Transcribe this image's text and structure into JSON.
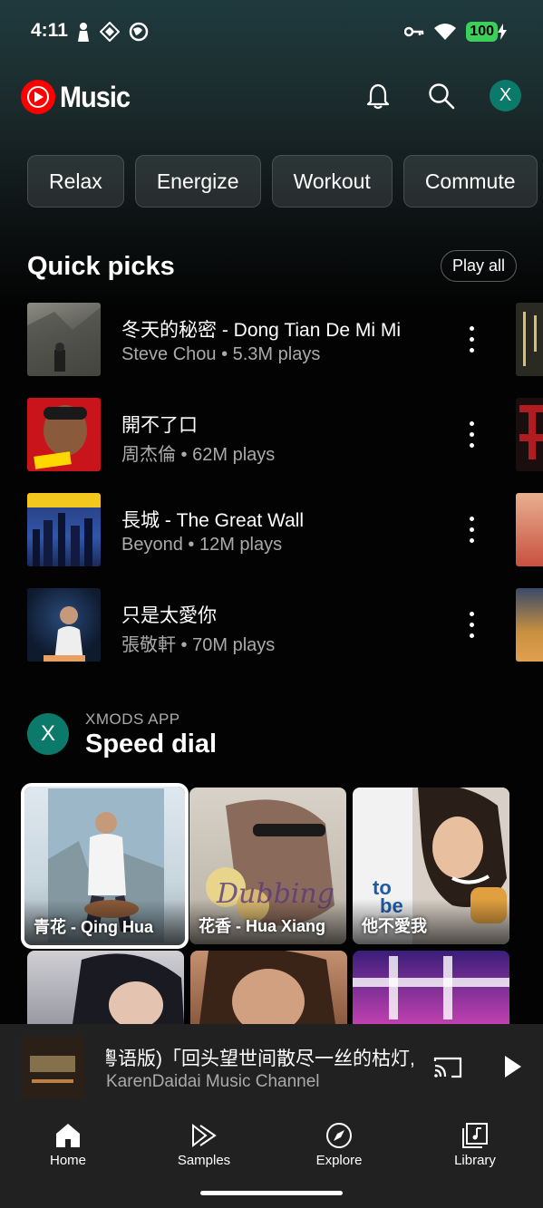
{
  "status_bar": {
    "time": "4:11",
    "battery": "100"
  },
  "app_bar": {
    "logo_text": "Music",
    "avatar_letter": "X",
    "icons": [
      "bell-icon",
      "search-icon"
    ]
  },
  "chips": [
    {
      "label": "Relax"
    },
    {
      "label": "Energize"
    },
    {
      "label": "Workout"
    },
    {
      "label": "Commute"
    }
  ],
  "quick_picks": {
    "title": "Quick picks",
    "play_all": "Play all",
    "items": [
      {
        "title": "冬天的秘密 - Dong Tian De Mi Mi",
        "subtitle": "Steve Chou • 5.3M plays"
      },
      {
        "title": "開不了口",
        "subtitle": "周杰倫 • 62M plays"
      },
      {
        "title": "長城 - The Great Wall",
        "subtitle": "Beyond • 12M plays"
      },
      {
        "title": "只是太愛你",
        "subtitle": "張敬軒 • 70M plays"
      }
    ]
  },
  "speed_dial": {
    "avatar_letter": "X",
    "overline": "XMODS APP",
    "title": "Speed dial",
    "tiles": [
      {
        "label": "青花 - Qing Hua"
      },
      {
        "label": "花香 - Hua Xiang"
      },
      {
        "label": "他不愛我"
      },
      {
        "label": ""
      },
      {
        "label": ""
      },
      {
        "label": ""
      }
    ]
  },
  "mini_player": {
    "title": "粵语版)「回头望世间散尽一丝的枯灯,",
    "artist": "KarenDaidai Music Channel"
  },
  "bottom_nav": [
    {
      "label": "Home",
      "icon": "home-icon"
    },
    {
      "label": "Samples",
      "icon": "samples-icon"
    },
    {
      "label": "Explore",
      "icon": "explore-icon"
    },
    {
      "label": "Library",
      "icon": "library-icon"
    }
  ],
  "colors": {
    "background": "#030303",
    "accent_red": "#ff0000",
    "avatar_teal": "#0c7a6a",
    "surface": "#212121"
  }
}
